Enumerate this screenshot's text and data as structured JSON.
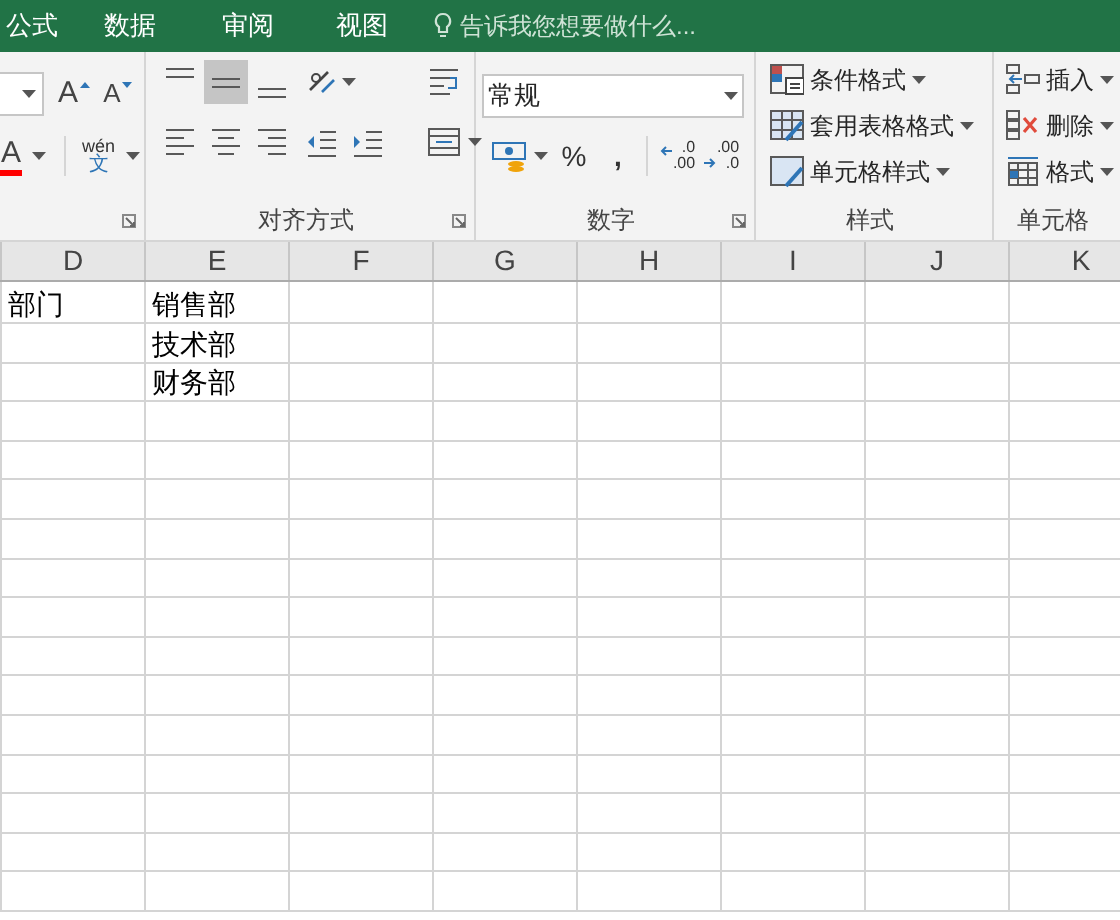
{
  "tabs": [
    {
      "label": "公式",
      "selected": false
    },
    {
      "label": "数据",
      "selected": false
    },
    {
      "label": "审阅",
      "selected": false
    },
    {
      "label": "视图",
      "selected": false
    }
  ],
  "tell_me": {
    "placeholder": "告诉我您想要做什么..."
  },
  "font_group": {
    "grow_font": "A",
    "shrink_font": "A",
    "font_color": "A",
    "phonetic_top": "wén",
    "phonetic_bottom": "文"
  },
  "alignment_group": {
    "label": "对齐方式",
    "vertical": [
      {
        "kind": "top",
        "selected": false
      },
      {
        "kind": "middle",
        "selected": true
      },
      {
        "kind": "bottom",
        "selected": false
      }
    ],
    "horizontal": [
      {
        "kind": "left",
        "selected": false
      },
      {
        "kind": "center",
        "selected": false
      },
      {
        "kind": "right",
        "selected": false
      }
    ]
  },
  "number_group": {
    "label": "数字",
    "format": "常规",
    "percent": "%",
    "comma": ",",
    "increase_decimal": [
      ".0",
      ".00"
    ],
    "decrease_decimal": [
      ".00",
      ".0"
    ]
  },
  "styles_group": {
    "label": "样式",
    "items": [
      {
        "kind": "conditional",
        "label": "条件格式"
      },
      {
        "kind": "table",
        "label": "套用表格格式"
      },
      {
        "kind": "cell",
        "label": "单元格样式"
      }
    ]
  },
  "cells_group": {
    "label": "单元格",
    "items": [
      {
        "kind": "insert",
        "label": "插入"
      },
      {
        "kind": "delete",
        "label": "删除"
      },
      {
        "kind": "format",
        "label": "格式"
      }
    ]
  },
  "sheet": {
    "columns": [
      "D",
      "E",
      "F",
      "G",
      "H",
      "I",
      "J",
      "K"
    ],
    "rows": [
      {
        "D": "部门",
        "E": "销售部"
      },
      {
        "E": "技术部"
      },
      {
        "E": "财务部"
      }
    ]
  }
}
